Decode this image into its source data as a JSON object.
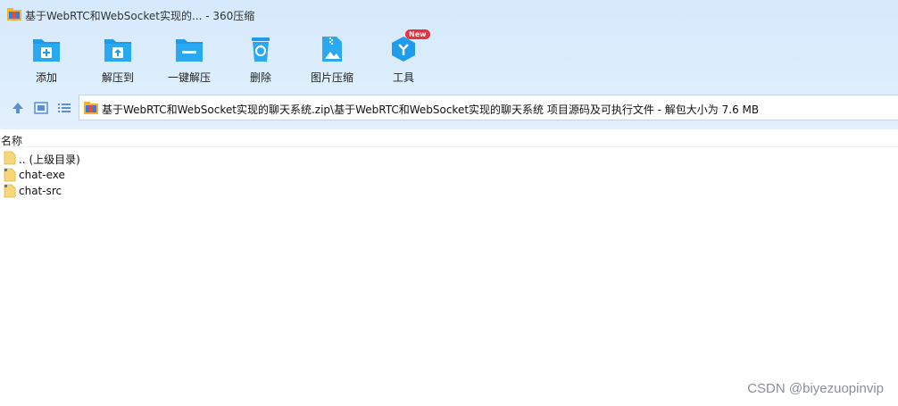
{
  "window": {
    "title": "基于WebRTC和WebSocket实现的... - 360压缩"
  },
  "toolbar": {
    "items": [
      {
        "label": "添加",
        "icon": "add-archive-icon"
      },
      {
        "label": "解压到",
        "icon": "extract-to-icon"
      },
      {
        "label": "一键解压",
        "icon": "one-click-extract-icon"
      },
      {
        "label": "删除",
        "icon": "delete-recycle-icon"
      },
      {
        "label": "图片压缩",
        "icon": "image-compress-icon"
      },
      {
        "label": "工具",
        "icon": "tools-icon",
        "badge": "New"
      }
    ]
  },
  "nav": {
    "path": "基于WebRTC和WebSocket实现的聊天系统.zip\\基于WebRTC和WebSocket实现的聊天系统 项目源码及可执行文件 - 解包大小为 7.6 MB"
  },
  "list": {
    "column_name": "名称",
    "rows": [
      {
        "name": ".. (上级目录)"
      },
      {
        "name": "chat-exe"
      },
      {
        "name": "chat-src"
      }
    ]
  },
  "watermark": "CSDN @biyezuopinvip",
  "colors": {
    "accent": "#1e9bea",
    "header_bg": "#d9ebfc",
    "badge": "#e8323c",
    "folder": "#f6d879"
  }
}
